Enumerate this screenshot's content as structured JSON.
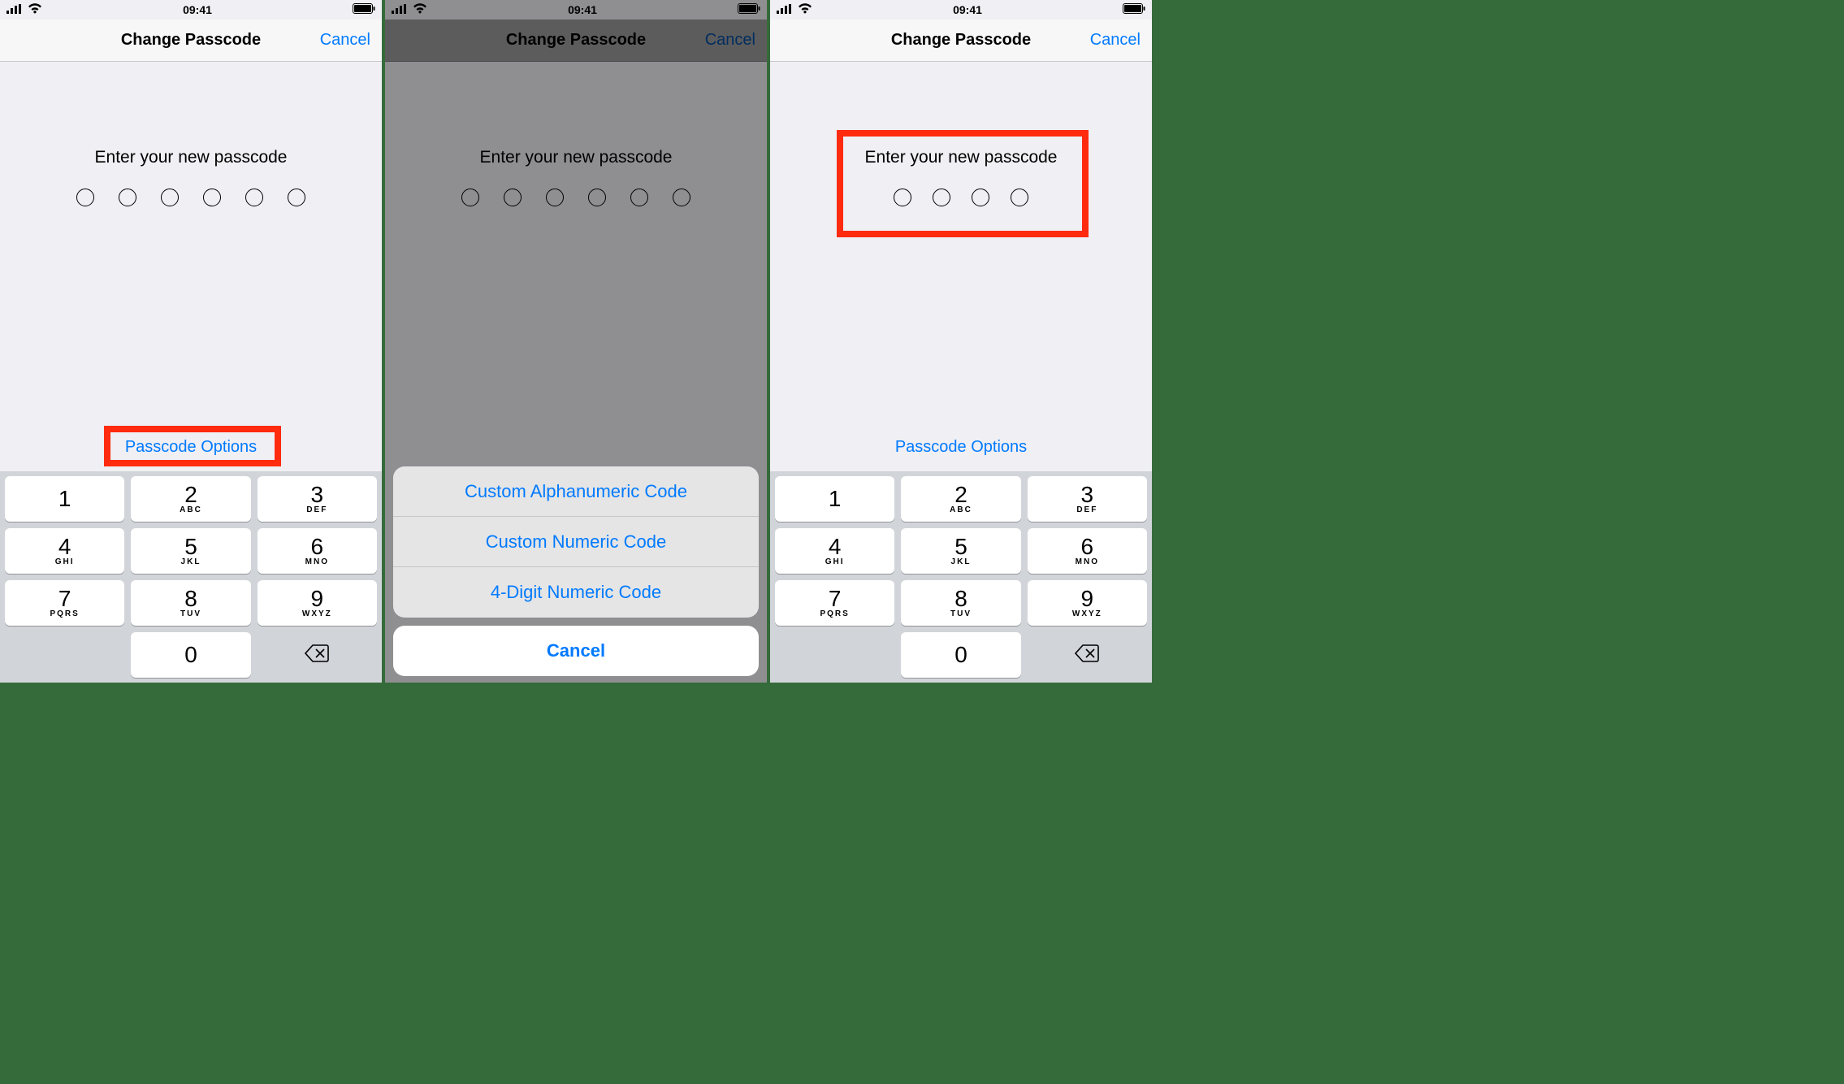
{
  "status": {
    "time": "09:41"
  },
  "nav": {
    "title": "Change Passcode",
    "cancel": "Cancel"
  },
  "content": {
    "prompt": "Enter your new passcode",
    "options": "Passcode Options"
  },
  "keypad": [
    {
      "num": "1",
      "sub": ""
    },
    {
      "num": "2",
      "sub": "ABC"
    },
    {
      "num": "3",
      "sub": "DEF"
    },
    {
      "num": "4",
      "sub": "GHI"
    },
    {
      "num": "5",
      "sub": "JKL"
    },
    {
      "num": "6",
      "sub": "MNO"
    },
    {
      "num": "7",
      "sub": "PQRS"
    },
    {
      "num": "8",
      "sub": "TUV"
    },
    {
      "num": "9",
      "sub": "WXYZ"
    },
    {
      "num": "0",
      "sub": ""
    }
  ],
  "sheet": {
    "items": [
      "Custom Alphanumeric Code",
      "Custom Numeric Code",
      "4-Digit Numeric Code"
    ],
    "cancel": "Cancel"
  }
}
